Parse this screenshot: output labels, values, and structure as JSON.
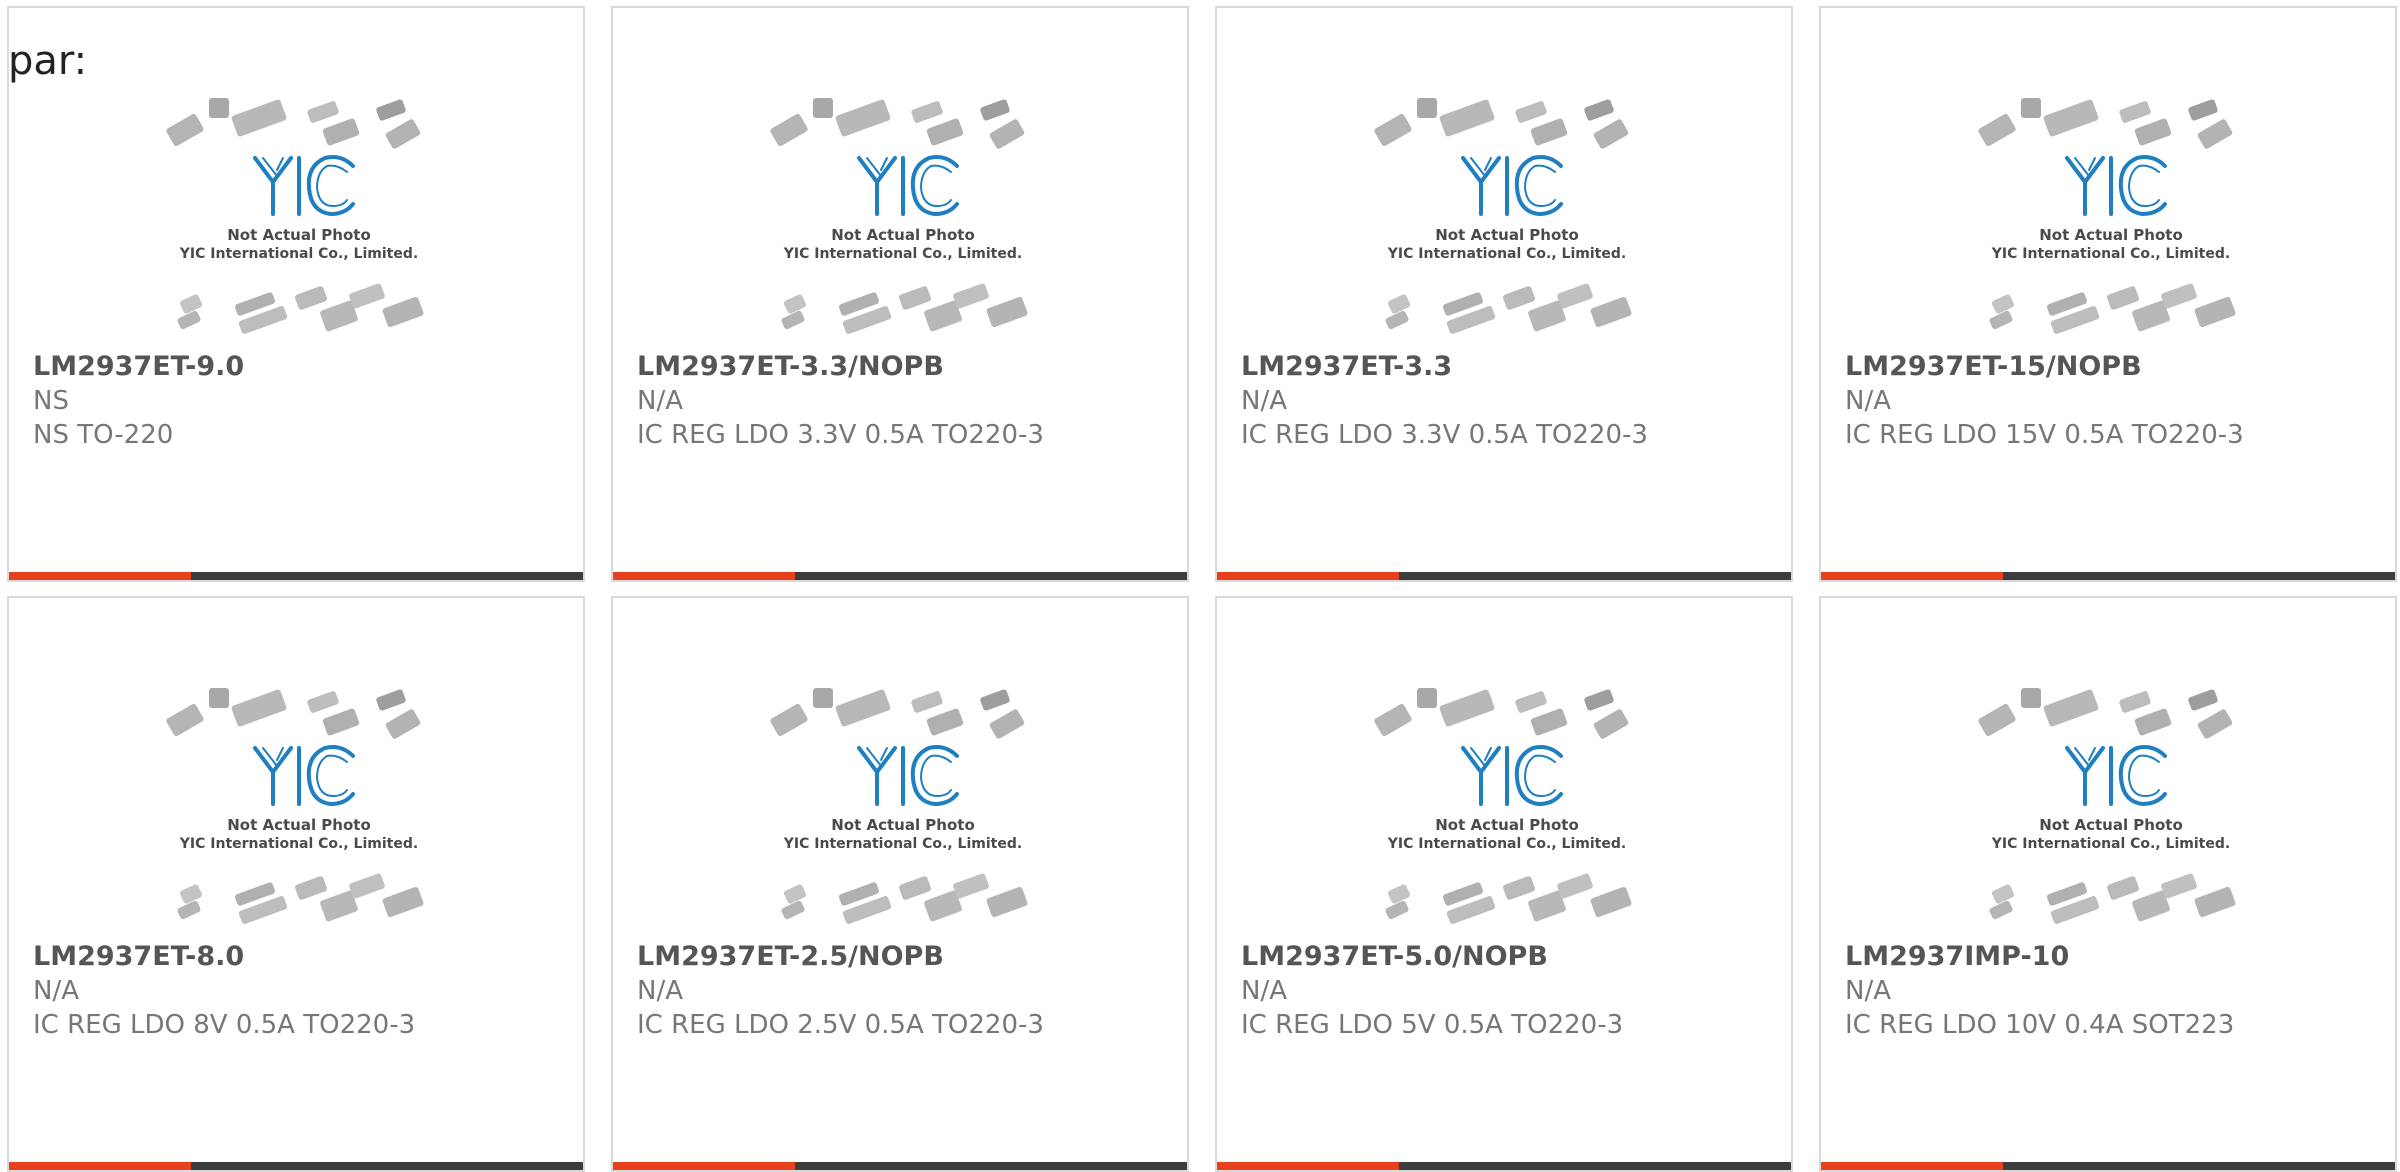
{
  "header": {
    "label": "par:"
  },
  "colors": {
    "accent": "#e8401c",
    "bar": "#3d3d3d",
    "logo_blue": "#1f7fc0"
  },
  "placeholder": {
    "line1": "Not Actual Photo",
    "line2": "YIC International Co., Limited.",
    "logo_text": "YIC"
  },
  "products": [
    {
      "part": "LM2937ET-9.0",
      "manufacturer": "NS",
      "description": "NS TO-220"
    },
    {
      "part": "LM2937ET-3.3/NOPB",
      "manufacturer": "N/A",
      "description": "IC REG LDO 3.3V 0.5A TO220-3"
    },
    {
      "part": "LM2937ET-3.3",
      "manufacturer": "N/A",
      "description": "IC REG LDO 3.3V 0.5A TO220-3"
    },
    {
      "part": "LM2937ET-15/NOPB",
      "manufacturer": "N/A",
      "description": "IC REG LDO 15V 0.5A TO220-3"
    },
    {
      "part": "LM2937ET-8.0",
      "manufacturer": "N/A",
      "description": "IC REG LDO 8V 0.5A TO220-3"
    },
    {
      "part": "LM2937ET-2.5/NOPB",
      "manufacturer": "N/A",
      "description": "IC REG LDO 2.5V 0.5A TO220-3"
    },
    {
      "part": "LM2937ET-5.0/NOPB",
      "manufacturer": "N/A",
      "description": "IC REG LDO 5V 0.5A TO220-3"
    },
    {
      "part": "LM2937IMP-10",
      "manufacturer": "N/A",
      "description": "IC REG LDO 10V 0.4A SOT223"
    }
  ]
}
